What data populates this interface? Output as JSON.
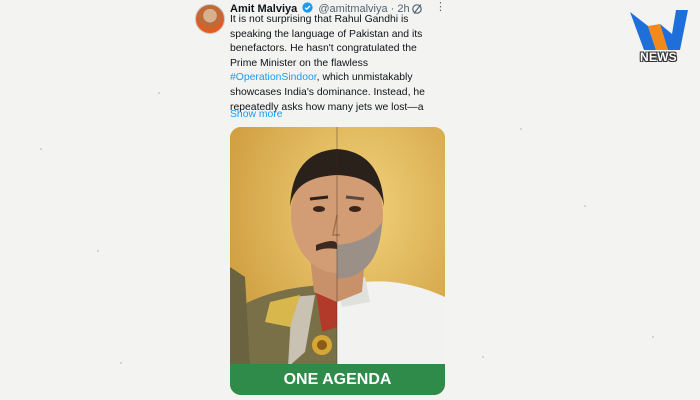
{
  "tweet": {
    "author_name": "Amit Malviya",
    "handle": "@amitmalviya",
    "separator": "·",
    "time": "2h",
    "text_lines": [
      "It is not surprising that Rahul Gandhi is",
      "speaking the language of Pakistan and its",
      "benefactors. He hasn't congratulated the",
      "Prime Minister on the flawless",
      "which unmistakably",
      "showcases India's dominance. Instead, he",
      "repeatedly asks how many jets we lost—a"
    ],
    "hashtag": "#OperationSindoor",
    "show_more": "Show more",
    "media_banner": "ONE AGENDA"
  },
  "logo": {
    "text": "NEWS"
  },
  "colors": {
    "link": "#1d9bf0",
    "banner_green": "#2e8b4a",
    "logo_blue": "#1e6fd9",
    "logo_orange": "#f28a1b"
  },
  "icons": {
    "verified": "verified-badge-icon",
    "grok": "grok-icon",
    "more": "more-options-icon"
  }
}
